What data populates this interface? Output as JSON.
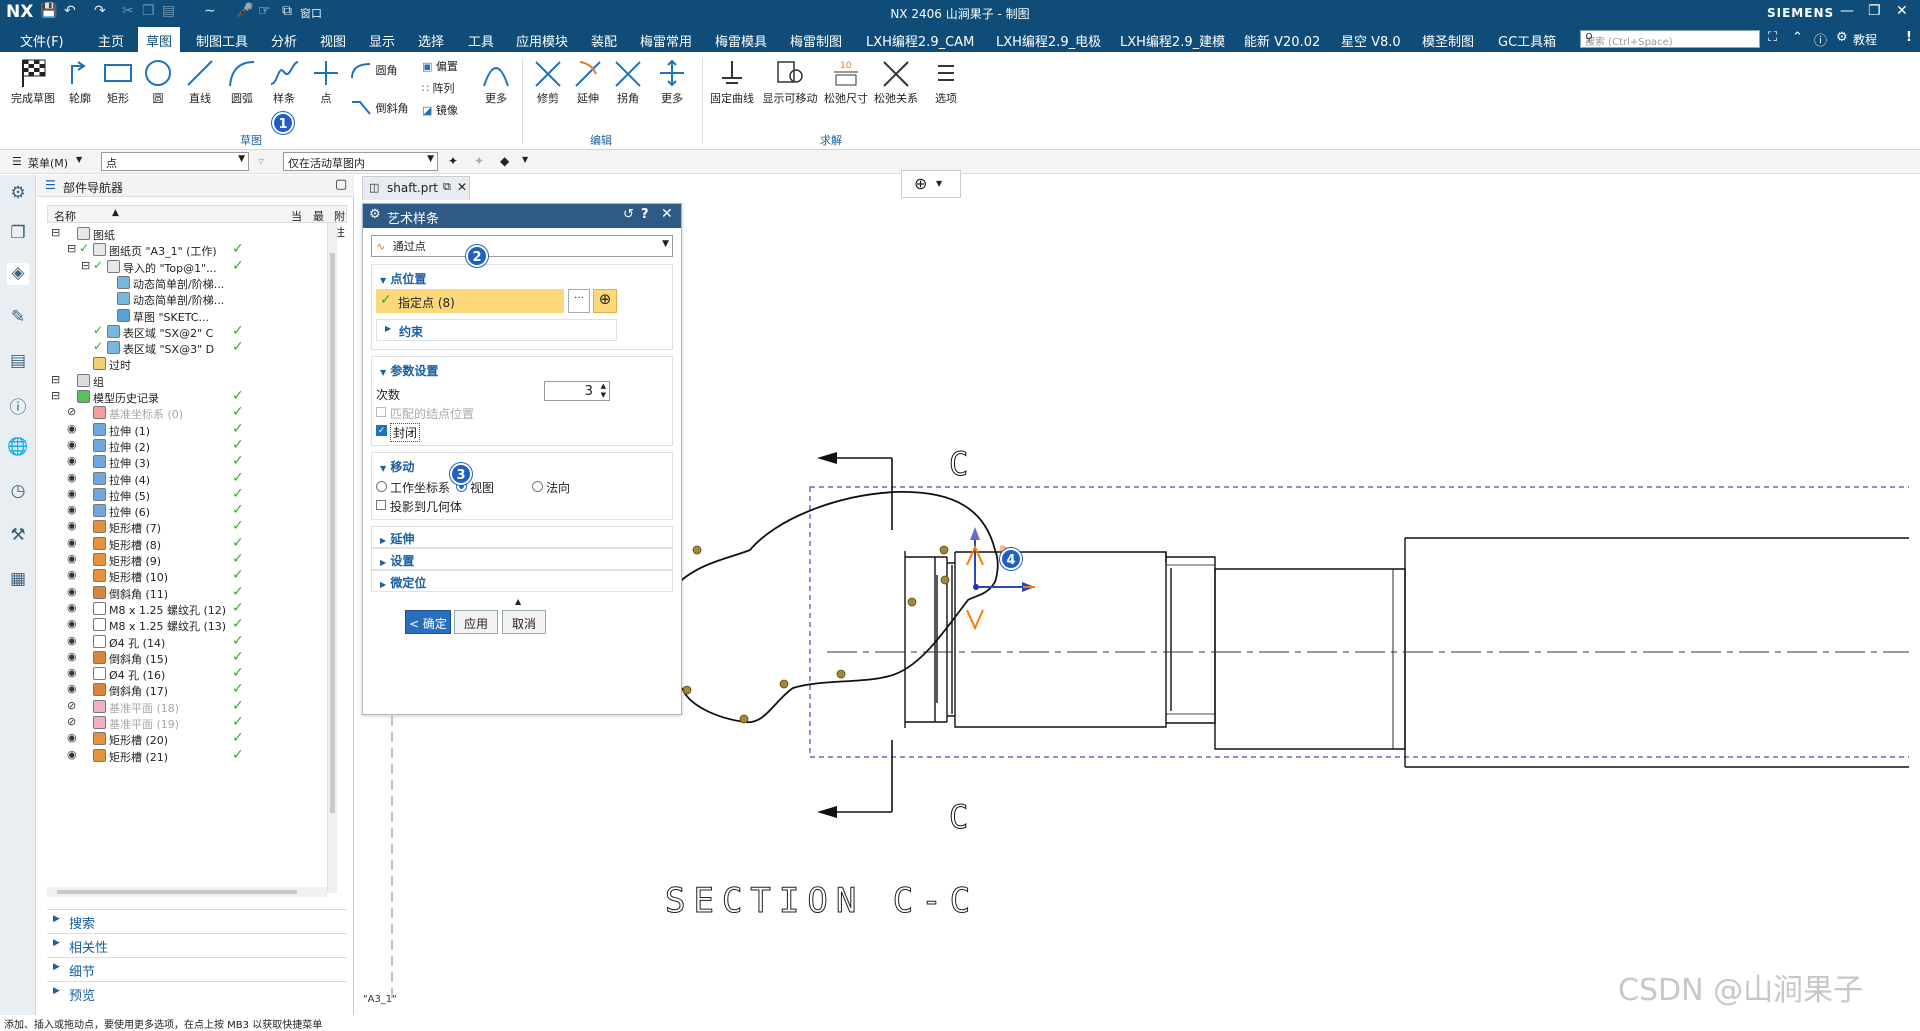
{
  "app": {
    "brand": "NX",
    "title": "NX 2406 山涧果子 - 制图",
    "vendor": "SIEMENS",
    "quick_window": "窗口"
  },
  "menu": {
    "tabs": [
      "文件(F)",
      "主页",
      "草图",
      "制图工具",
      "分析",
      "视图",
      "显示",
      "选择",
      "工具",
      "应用模块",
      "装配",
      "梅雷常用",
      "梅雷模具",
      "梅雷制图",
      "LXH编程2.9_CAM",
      "LXH编程2.9_电极",
      "LXH编程2.9_建模",
      "能新 V20.02",
      "星空 V8.0",
      "模圣制图",
      "GC工具箱"
    ],
    "search_placeholder": "搜索 (Ctrl+Space)",
    "tutorial": "教程"
  },
  "ribbon": {
    "sketch": [
      "完成草图",
      "轮廓",
      "矩形",
      "圆",
      "直线",
      "圆弧",
      "样条",
      "点"
    ],
    "small": [
      "圆角",
      "倒斜角",
      "偏置",
      "阵列",
      "镜像"
    ],
    "more": "更多",
    "edit": [
      "修剪",
      "延伸",
      "拐角",
      "更多"
    ],
    "solve": [
      "固定曲线",
      "显示可移动",
      "松弛尺寸",
      "松弛关系",
      "选项"
    ],
    "groups": {
      "sketch": "草图",
      "edit": "编辑",
      "solve": "求解"
    }
  },
  "toolbar2": {
    "menu": "菜单(M)",
    "filter": "点",
    "scope": "仅在活动草图内"
  },
  "navigator": {
    "title": "部件导航器",
    "col_name": "名称",
    "col_cur": "当",
    "col_latest": "最",
    "col_note": "附注",
    "rows": [
      {
        "t": "图纸",
        "lvl": 0,
        "ck": false,
        "grey": false,
        "icon": "sheet"
      },
      {
        "t": "图纸页 \"A3_1\" (工作)",
        "lvl": 1,
        "ck": true,
        "grey": false,
        "icon": "sheet"
      },
      {
        "t": "导入的 \"Top@1\"...",
        "lvl": 2,
        "ck": true,
        "grey": false,
        "icon": "view"
      },
      {
        "t": "动态简单剖/阶梯...",
        "lvl": 3,
        "ck": false,
        "grey": false,
        "icon": "sec"
      },
      {
        "t": "动态简单剖/阶梯...",
        "lvl": 3,
        "ck": false,
        "grey": false,
        "icon": "sec"
      },
      {
        "t": "草图 \"SKETC...",
        "lvl": 3,
        "ck": false,
        "grey": false,
        "icon": "sketch"
      },
      {
        "t": "表区域 \"SX@2\" C",
        "lvl": 2,
        "ck": true,
        "grey": false,
        "icon": "sec"
      },
      {
        "t": "表区域 \"SX@3\" D",
        "lvl": 2,
        "ck": true,
        "grey": false,
        "icon": "sec"
      },
      {
        "t": "过时",
        "lvl": 1,
        "ck": false,
        "grey": false,
        "icon": "folder"
      },
      {
        "t": "组",
        "lvl": 0,
        "ck": false,
        "grey": false,
        "icon": "group"
      },
      {
        "t": "模型历史记录",
        "lvl": 0,
        "ck": true,
        "grey": false,
        "icon": "hist"
      },
      {
        "t": "基准坐标系 (0)",
        "lvl": 1,
        "ck": true,
        "grey": true,
        "icon": "csys"
      },
      {
        "t": "拉伸 (1)",
        "lvl": 1,
        "ck": true,
        "grey": false,
        "icon": "ext"
      },
      {
        "t": "拉伸 (2)",
        "lvl": 1,
        "ck": true,
        "grey": false,
        "icon": "ext"
      },
      {
        "t": "拉伸 (3)",
        "lvl": 1,
        "ck": true,
        "grey": false,
        "icon": "ext"
      },
      {
        "t": "拉伸 (4)",
        "lvl": 1,
        "ck": true,
        "grey": false,
        "icon": "ext"
      },
      {
        "t": "拉伸 (5)",
        "lvl": 1,
        "ck": true,
        "grey": false,
        "icon": "ext"
      },
      {
        "t": "拉伸 (6)",
        "lvl": 1,
        "ck": true,
        "grey": false,
        "icon": "ext"
      },
      {
        "t": "矩形槽 (7)",
        "lvl": 1,
        "ck": true,
        "grey": false,
        "icon": "groove"
      },
      {
        "t": "矩形槽 (8)",
        "lvl": 1,
        "ck": true,
        "grey": false,
        "icon": "groove"
      },
      {
        "t": "矩形槽 (9)",
        "lvl": 1,
        "ck": true,
        "grey": false,
        "icon": "groove"
      },
      {
        "t": "矩形槽 (10)",
        "lvl": 1,
        "ck": true,
        "grey": false,
        "icon": "groove"
      },
      {
        "t": "倒斜角 (11)",
        "lvl": 1,
        "ck": true,
        "grey": false,
        "icon": "cham"
      },
      {
        "t": "M8 x 1.25 螺纹孔 (12)",
        "lvl": 1,
        "ck": true,
        "grey": false,
        "icon": "hole"
      },
      {
        "t": "M8 x 1.25 螺纹孔 (13)",
        "lvl": 1,
        "ck": true,
        "grey": false,
        "icon": "hole"
      },
      {
        "t": "Ø4 孔 (14)",
        "lvl": 1,
        "ck": true,
        "grey": false,
        "icon": "hole"
      },
      {
        "t": "倒斜角 (15)",
        "lvl": 1,
        "ck": true,
        "grey": false,
        "icon": "cham"
      },
      {
        "t": "Ø4 孔 (16)",
        "lvl": 1,
        "ck": true,
        "grey": false,
        "icon": "hole"
      },
      {
        "t": "倒斜角 (17)",
        "lvl": 1,
        "ck": true,
        "grey": false,
        "icon": "cham"
      },
      {
        "t": "基准平面 (18)",
        "lvl": 1,
        "ck": true,
        "grey": true,
        "icon": "plane"
      },
      {
        "t": "基准平面 (19)",
        "lvl": 1,
        "ck": true,
        "grey": true,
        "icon": "plane"
      },
      {
        "t": "矩形槽 (20)",
        "lvl": 1,
        "ck": true,
        "grey": false,
        "icon": "groove"
      },
      {
        "t": "矩形槽 (21)",
        "lvl": 1,
        "ck": true,
        "grey": false,
        "icon": "groove"
      }
    ],
    "sections": [
      "搜索",
      "相关性",
      "细节",
      "预览"
    ]
  },
  "doc_tab": "shaft.prt",
  "dialog": {
    "title": "艺术样条",
    "type": "通过点",
    "sec_points": "点位置",
    "specify": "指定点 (8)",
    "constraints": "约束",
    "sec_params": "参数设置",
    "degree_label": "次数",
    "degree": "3",
    "match_knots": "匹配的结点位置",
    "closed": "封闭",
    "sec_move": "移动",
    "move_opts": [
      "工作坐标系",
      "视图",
      "法向"
    ],
    "project": "投影到几何体",
    "extend": "延伸",
    "settings": "设置",
    "fine": "微定位",
    "ok": "< 确定 >",
    "apply": "应用",
    "cancel": "取消"
  },
  "drawing": {
    "section_label": "C",
    "section_title": "SECTION  C-C",
    "sheet_label": "\"A3_1\"",
    "dim_10": "10"
  },
  "badges": [
    "1",
    "2",
    "3",
    "4"
  ],
  "status": "添加、插入或拖动点，要使用更多选项，在点上按 MB3 以获取快捷菜单",
  "watermark": "CSDN @山涧果子",
  "colors": {
    "title_bar": "#0f4d78",
    "accent": "#1a5fa0",
    "highlight": "#fcd87a",
    "check": "#2bb12b",
    "badge": "#1f5fc4",
    "spline_point": "#b19a3e"
  }
}
